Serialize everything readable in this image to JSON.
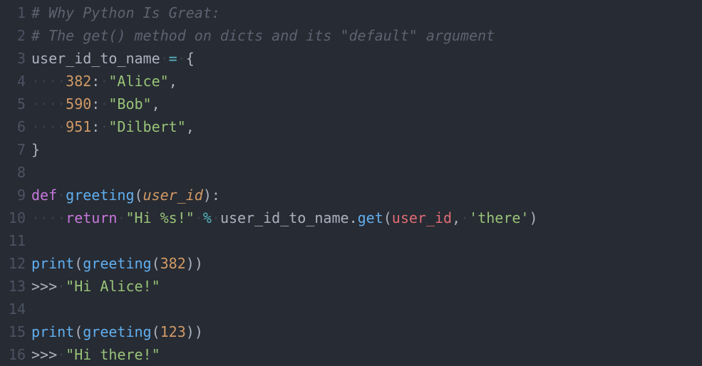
{
  "colors": {
    "background": "#272b33",
    "gutter": "#4b5363",
    "whitespace": "#3b4048",
    "comment": "#5c6370",
    "default": "#abb2bf",
    "keyword": "#c678dd",
    "function": "#61afef",
    "string": "#98c379",
    "number": "#d19a66",
    "operator": "#56b6c2",
    "variable": "#e06c75"
  },
  "line_numbers": [
    "1",
    "2",
    "3",
    "4",
    "5",
    "6",
    "7",
    "8",
    "9",
    "10",
    "11",
    "12",
    "13",
    "14",
    "15",
    "16"
  ],
  "lines": [
    [
      [
        "cm",
        "# Why Python Is Great:"
      ]
    ],
    [
      [
        "cm",
        "# The get() method on dicts and its \"default\" argument"
      ]
    ],
    [
      [
        "id",
        "user_id_to_name"
      ],
      [
        "ws",
        "·"
      ],
      [
        "eq",
        "="
      ],
      [
        "ws",
        "·"
      ],
      [
        "op",
        "{"
      ]
    ],
    [
      [
        "ws",
        "····"
      ],
      [
        "num",
        "382"
      ],
      [
        "op",
        ":"
      ],
      [
        "ws",
        "·"
      ],
      [
        "str",
        "\"Alice\""
      ],
      [
        "op",
        ","
      ]
    ],
    [
      [
        "ws",
        "····"
      ],
      [
        "num",
        "590"
      ],
      [
        "op",
        ":"
      ],
      [
        "ws",
        "·"
      ],
      [
        "str",
        "\"Bob\""
      ],
      [
        "op",
        ","
      ]
    ],
    [
      [
        "ws",
        "····"
      ],
      [
        "num",
        "951"
      ],
      [
        "op",
        ":"
      ],
      [
        "ws",
        "·"
      ],
      [
        "str",
        "\"Dilbert\""
      ],
      [
        "op",
        ","
      ]
    ],
    [
      [
        "op",
        "}"
      ]
    ],
    [],
    [
      [
        "kw",
        "def"
      ],
      [
        "ws",
        "·"
      ],
      [
        "fn",
        "greeting"
      ],
      [
        "op",
        "("
      ],
      [
        "par",
        "user_id"
      ],
      [
        "op",
        ")"
      ],
      [
        "op",
        ":"
      ]
    ],
    [
      [
        "ws",
        "····"
      ],
      [
        "kw",
        "return"
      ],
      [
        "ws",
        "·"
      ],
      [
        "str",
        "\"Hi %s!\""
      ],
      [
        "ws",
        "·"
      ],
      [
        "pct",
        "%"
      ],
      [
        "ws",
        "·"
      ],
      [
        "id",
        "user_id_to_name"
      ],
      [
        "op",
        "."
      ],
      [
        "fn",
        "get"
      ],
      [
        "op",
        "("
      ],
      [
        "var",
        "user_id"
      ],
      [
        "op",
        ","
      ],
      [
        "ws",
        "·"
      ],
      [
        "str",
        "'there'"
      ],
      [
        "op",
        ")"
      ]
    ],
    [],
    [
      [
        "fn",
        "print"
      ],
      [
        "op",
        "("
      ],
      [
        "fn",
        "greeting"
      ],
      [
        "op",
        "("
      ],
      [
        "num",
        "382"
      ],
      [
        "op",
        ")"
      ],
      [
        "op",
        ")"
      ]
    ],
    [
      [
        "op",
        ">>>"
      ],
      [
        "ws",
        "·"
      ],
      [
        "str",
        "\"Hi Alice!\""
      ]
    ],
    [],
    [
      [
        "fn",
        "print"
      ],
      [
        "op",
        "("
      ],
      [
        "fn",
        "greeting"
      ],
      [
        "op",
        "("
      ],
      [
        "num",
        "123"
      ],
      [
        "op",
        ")"
      ],
      [
        "op",
        ")"
      ]
    ],
    [
      [
        "op",
        ">>>"
      ],
      [
        "ws",
        "·"
      ],
      [
        "str",
        "\"Hi there!\""
      ]
    ]
  ]
}
